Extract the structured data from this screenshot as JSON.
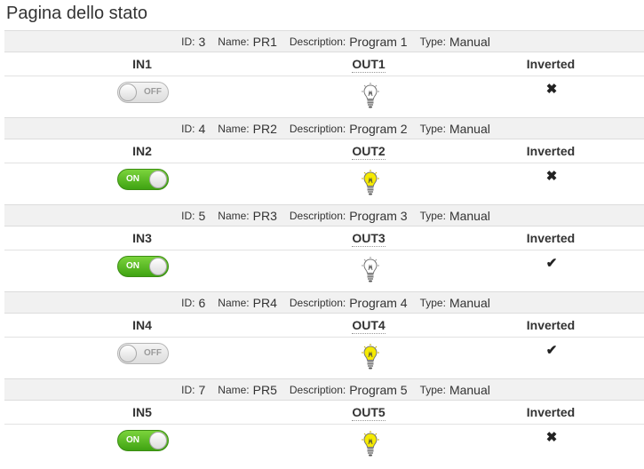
{
  "page": {
    "title": "Pagina dello stato"
  },
  "labels": {
    "id": "ID:",
    "name": "Name:",
    "description": "Description:",
    "type": "Type:",
    "inverted": "Inverted"
  },
  "programs": [
    {
      "id": "3",
      "name": "PR1",
      "description": "Program 1",
      "type": "Manual",
      "in_label": "IN1",
      "out_label": "OUT1",
      "in_state": "off",
      "in_text": "OFF",
      "out_state": "off",
      "inverted": false,
      "inverted_icon": "cross-icon"
    },
    {
      "id": "4",
      "name": "PR2",
      "description": "Program 2",
      "type": "Manual",
      "in_label": "IN2",
      "out_label": "OUT2",
      "in_state": "on",
      "in_text": "ON",
      "out_state": "on",
      "inverted": false,
      "inverted_icon": "cross-icon"
    },
    {
      "id": "5",
      "name": "PR3",
      "description": "Program 3",
      "type": "Manual",
      "in_label": "IN3",
      "out_label": "OUT3",
      "in_state": "on",
      "in_text": "ON",
      "out_state": "off",
      "inverted": true,
      "inverted_icon": "check-icon"
    },
    {
      "id": "6",
      "name": "PR4",
      "description": "Program 4",
      "type": "Manual",
      "in_label": "IN4",
      "out_label": "OUT4",
      "in_state": "off",
      "in_text": "OFF",
      "out_state": "on",
      "inverted": true,
      "inverted_icon": "check-icon"
    },
    {
      "id": "7",
      "name": "PR5",
      "description": "Program 5",
      "type": "Manual",
      "in_label": "IN5",
      "out_label": "OUT5",
      "in_state": "on",
      "in_text": "ON",
      "out_state": "on",
      "inverted": false,
      "inverted_icon": "cross-icon"
    }
  ],
  "colors": {
    "toggle_on": "#4cb51c",
    "toggle_off": "#e6e6e6",
    "bulb_on": "#f5ea00",
    "bulb_off": "#ffffff",
    "info_row_bg": "#f1f1f1"
  }
}
